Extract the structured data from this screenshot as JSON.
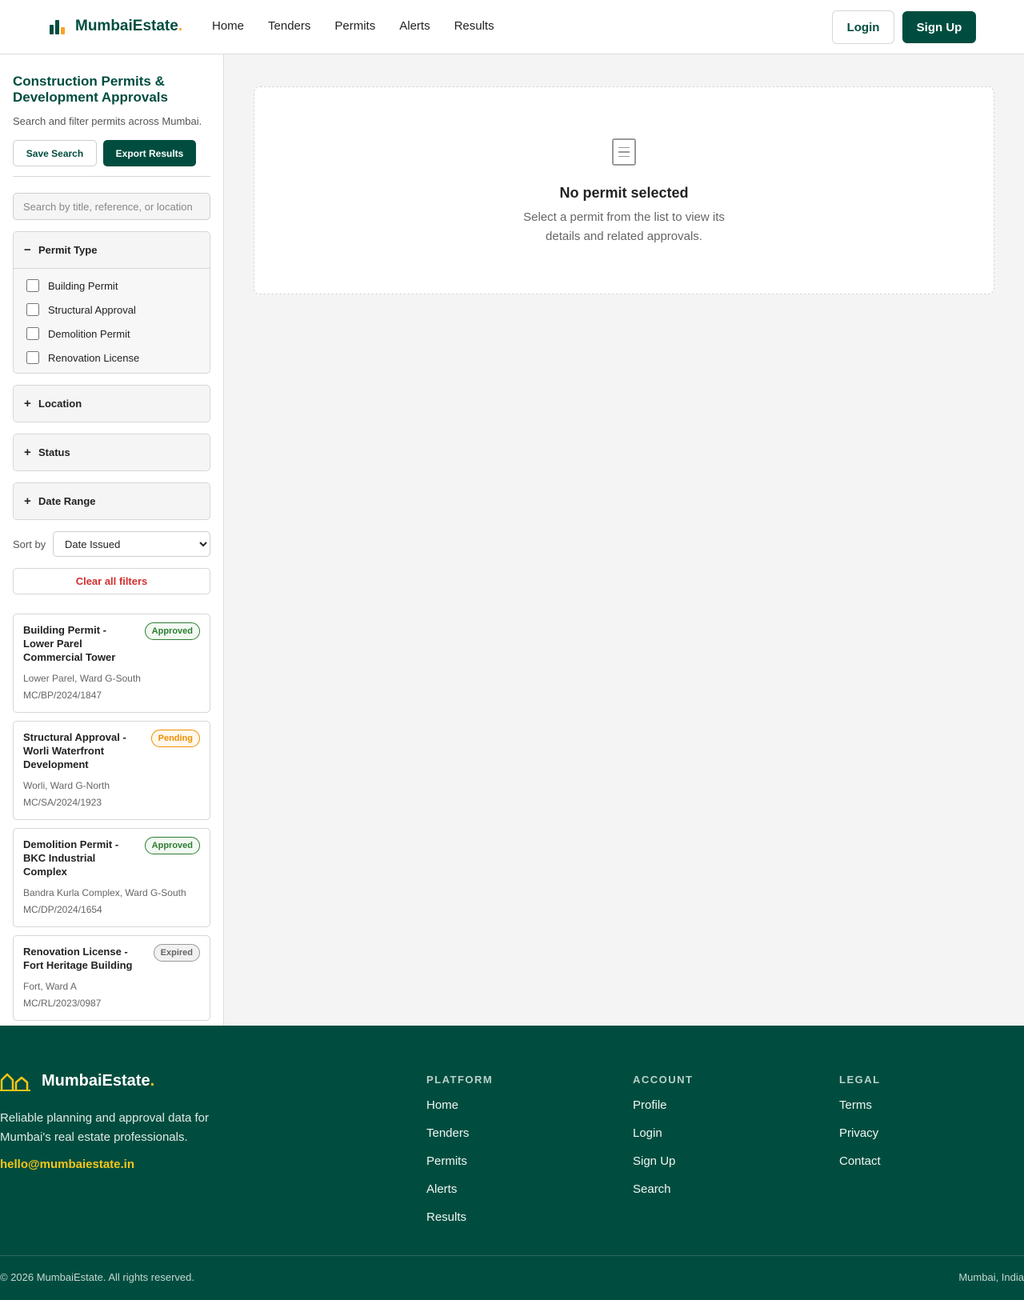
{
  "colors": {
    "brand": "#004d3f",
    "accent": "#f5a623",
    "danger": "#d32f2f",
    "approved": "#2e7d32",
    "pending": "#ef8f00"
  },
  "header": {
    "logo_text": "MumbaiEstate",
    "logo_dot": ".",
    "nav": [
      "Home",
      "Tenders",
      "Permits",
      "Alerts",
      "Results"
    ],
    "login_label": "Login",
    "signup_label": "Sign Up"
  },
  "sidebar": {
    "title": "Construction Permits & Development Approvals",
    "subtitle": "Search and filter permits across Mumbai.",
    "save_label": "Save Search",
    "export_label": "Export Results",
    "search_placeholder": "Search by title, reference, or location",
    "filters": {
      "permit_type": {
        "sign": "−",
        "label": "Permit Type",
        "options": [
          "Building Permit",
          "Structural Approval",
          "Demolition Permit",
          "Renovation License"
        ]
      },
      "location": {
        "sign": "+",
        "label": "Location"
      },
      "status": {
        "sign": "+",
        "label": "Status"
      },
      "date_range": {
        "sign": "+",
        "label": "Date Range"
      }
    },
    "sort_label": "Sort by",
    "sort_selected": "Date Issued",
    "clear_label": "Clear all filters"
  },
  "results": [
    {
      "title": "Building Permit - Lower Parel Commercial Tower",
      "location": "Lower Parel, Ward G-South",
      "reference": "MC/BP/2024/1847",
      "status": "Approved"
    },
    {
      "title": "Structural Approval - Worli Waterfront Development",
      "location": "Worli, Ward G-North",
      "reference": "MC/SA/2024/1923",
      "status": "Pending"
    },
    {
      "title": "Demolition Permit - BKC Industrial Complex",
      "location": "Bandra Kurla Complex, Ward G-South",
      "reference": "MC/DP/2024/1654",
      "status": "Approved"
    },
    {
      "title": "Renovation License - Fort Heritage Building",
      "location": "Fort, Ward A",
      "reference": "MC/RL/2023/0987",
      "status": "Expired"
    }
  ],
  "detail": {
    "empty_title": "No permit selected",
    "empty_text": "Select a permit from the list to view its details and related approvals."
  },
  "footer": {
    "brand": "MumbaiEstate",
    "brand_dot": ".",
    "tagline": "Reliable planning and approval data for Mumbai's real estate professionals.",
    "email": "hello@mumbaiestate.in",
    "platform": {
      "heading": "PLATFORM",
      "links": [
        "Home",
        "Tenders",
        "Permits",
        "Alerts",
        "Results"
      ]
    },
    "account": {
      "heading": "ACCOUNT",
      "links": [
        "Profile",
        "Login",
        "Sign Up",
        "Search"
      ]
    },
    "legal": {
      "heading": "LEGAL",
      "links": [
        "Terms",
        "Privacy",
        "Contact"
      ]
    },
    "copyright": "© 2026 MumbaiEstate. All rights reserved.",
    "location": "Mumbai, India"
  }
}
